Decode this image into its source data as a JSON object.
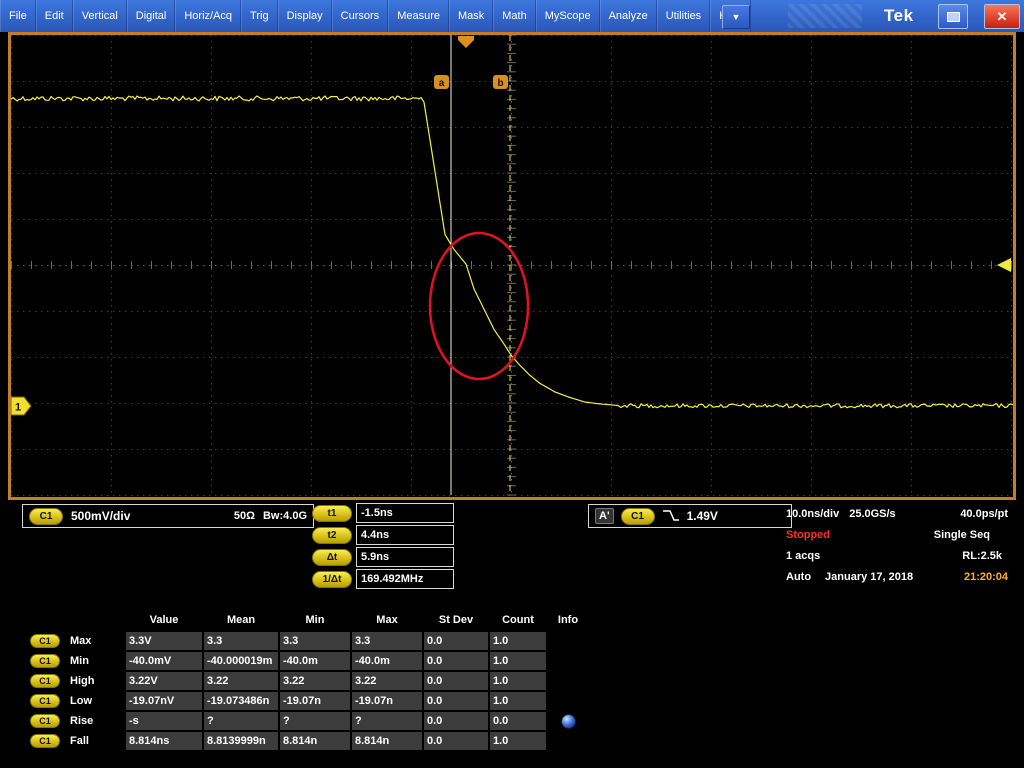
{
  "menu": {
    "items": [
      "File",
      "Edit",
      "Vertical",
      "Digital",
      "Horiz/Acq",
      "Trig",
      "Display",
      "Cursors",
      "Measure",
      "Mask",
      "Math",
      "MyScope",
      "Analyze",
      "Utilities",
      "Help"
    ],
    "dropdown": "▼",
    "logo": "Tek",
    "close_glyph": "✕"
  },
  "scope": {
    "cursor_a_label": "a",
    "cursor_b_label": "b",
    "channel_marker": "1",
    "cursors_ns": {
      "t1": -1.5,
      "t2": 4.4
    },
    "waveform": {
      "volts_per_div": 0.5,
      "ns_per_div": 10,
      "high_v": 3.3,
      "low_v": -0.04,
      "trigger_level_v": 1.49,
      "fall_points_ns_v": [
        [
          -4.2,
          3.26
        ],
        [
          -2.1,
          1.82
        ],
        [
          -1.2,
          1.66
        ],
        [
          0,
          1.5
        ],
        [
          0.8,
          1.23
        ],
        [
          1.8,
          1.01
        ],
        [
          2.8,
          0.79
        ],
        [
          3.8,
          0.63
        ],
        [
          4.5,
          0.51
        ],
        [
          5.3,
          0.41
        ],
        [
          6.3,
          0.3
        ],
        [
          7.3,
          0.21
        ],
        [
          8.9,
          0.11
        ],
        [
          10.4,
          0.05
        ],
        [
          11.9,
          0.0
        ],
        [
          13.4,
          -0.02
        ],
        [
          15.5,
          -0.04
        ]
      ]
    },
    "colors": {
      "trace": "#f6ef45",
      "grid": "#3f3f33",
      "axis": "#62625a",
      "cursor_a": "#f0f0d8",
      "cursor_b": "#f0e840",
      "annotation": "#e11222",
      "marker_orange": "#e09020",
      "frame_orange": "#c08028"
    }
  },
  "readouts": {
    "ch1": {
      "badge": "C1",
      "scale": "500mV/div",
      "impedance": "50Ω",
      "bandwidth": "Bw:4.0G"
    },
    "cursors": [
      {
        "label": "t1",
        "value": "-1.5ns"
      },
      {
        "label": "t2",
        "value": "4.4ns"
      },
      {
        "label": "Δt",
        "value": "5.9ns"
      },
      {
        "label": "1/Δt",
        "value": "169.492MHz"
      }
    ],
    "trigger": {
      "aux": "A'",
      "source": "C1",
      "slope": "falling",
      "level": "1.49V"
    },
    "acq": {
      "timebase": "10.0ns/div",
      "sample_rate": "25.0GS/s",
      "resolution": "40.0ps/pt",
      "status": "Stopped",
      "mode": "Single Seq",
      "acquisitions": "1 acqs",
      "record_length": "RL:2.5k",
      "trigger_mode": "Auto",
      "date": "January 17, 2018",
      "time": "21:20:04"
    }
  },
  "measurements": {
    "headers": [
      "Value",
      "Mean",
      "Min",
      "Max",
      "St Dev",
      "Count",
      "Info"
    ],
    "rows": [
      {
        "source": "C1",
        "name": "Max",
        "value": "3.3V",
        "mean": "3.3",
        "min": "3.3",
        "max": "3.3",
        "stdev": "0.0",
        "count": "1.0",
        "info": ""
      },
      {
        "source": "C1",
        "name": "Min",
        "value": "-40.0mV",
        "mean": "-40.000019m",
        "min": "-40.0m",
        "max": "-40.0m",
        "stdev": "0.0",
        "count": "1.0",
        "info": ""
      },
      {
        "source": "C1",
        "name": "High",
        "value": "3.22V",
        "mean": "3.22",
        "min": "3.22",
        "max": "3.22",
        "stdev": "0.0",
        "count": "1.0",
        "info": ""
      },
      {
        "source": "C1",
        "name": "Low",
        "value": "-19.07nV",
        "mean": "-19.073486n",
        "min": "-19.07n",
        "max": "-19.07n",
        "stdev": "0.0",
        "count": "1.0",
        "info": ""
      },
      {
        "source": "C1",
        "name": "Rise",
        "value": "-s",
        "mean": "?",
        "min": "?",
        "max": "?",
        "stdev": "0.0",
        "count": "0.0",
        "info": "globe"
      },
      {
        "source": "C1",
        "name": "Fall",
        "value": "8.814ns",
        "mean": "8.8139999n",
        "min": "8.814n",
        "max": "8.814n",
        "stdev": "0.0",
        "count": "1.0",
        "info": ""
      }
    ]
  }
}
